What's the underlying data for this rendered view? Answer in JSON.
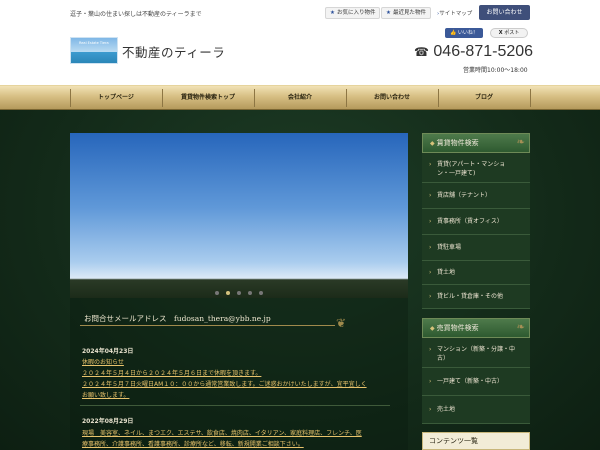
{
  "header": {
    "tagline": "逗子・葉山の住まい探しは不動産のティーラまで",
    "favorites_label": "お気に入り物件",
    "recent_label": "最近見た物件",
    "sitemap_label": "サイトマップ",
    "contact_label": "お問い合わせ",
    "logo_img_text": "Real Estate Tiera",
    "logo_text": "不動産のティーラ",
    "like_label": "いいね！",
    "post_label": "ポスト",
    "phone": "046-871-5206",
    "hours": "営業時間10:00～18:00"
  },
  "nav": {
    "items": [
      "トップページ",
      "賃貸物件検索トップ",
      "会社紹介",
      "お問い合わせ",
      "ブログ"
    ]
  },
  "slider": {
    "active_index": 1
  },
  "content": {
    "mail_line": "お問合せメールアドレス　fudosan_thera@ybb.ne.jp",
    "news": [
      {
        "date": "2024年04月23日",
        "links": [
          "休暇のお知らせ",
          "２０２４年５月４日から２０２４年５月６日まで休暇を頂きます。",
          "２０２４年５月７日火曜日AM１０：００から通常営業致します。ご迷惑おかけいたしますが、宜平宜しく",
          "お願い致します。"
        ]
      },
      {
        "date": "2022年08月29日",
        "links": [
          "現場　美容室、ネイル、まつエク、エステサ、飲食店、焼肉店、イタリアン、家庭料理店、フレンチ、医",
          "療事務所、介護事務所、看護事務所、診療所など、移転、新規開業ご相談下さい。"
        ]
      }
    ]
  },
  "sidebar": {
    "rent_heading": "賃貸物件検索",
    "rent_items": [
      [
        "賃貸(アパート・マンショ",
        "ン・一戸建て)"
      ],
      [
        "賃店舗（テナント）"
      ],
      [
        "賃事務所（賃オフィス）"
      ],
      [
        "貸駐車場"
      ],
      [
        "貸土地"
      ],
      [
        "貸ビル・貸倉庫・その他"
      ]
    ],
    "sale_heading": "売買物件検索",
    "sale_items": [
      [
        "マンション（新築・分譲・中",
        "古）"
      ],
      [
        "一戸建て（新築・中古）"
      ],
      [
        "売土地"
      ]
    ],
    "contents_heading": "コンテンツ一覧"
  },
  "colors": {
    "nav_gold": "#d7bf84",
    "main_green": "#132a19",
    "link_gold": "#e8c36c",
    "contact_navy": "#3f4f7a"
  }
}
